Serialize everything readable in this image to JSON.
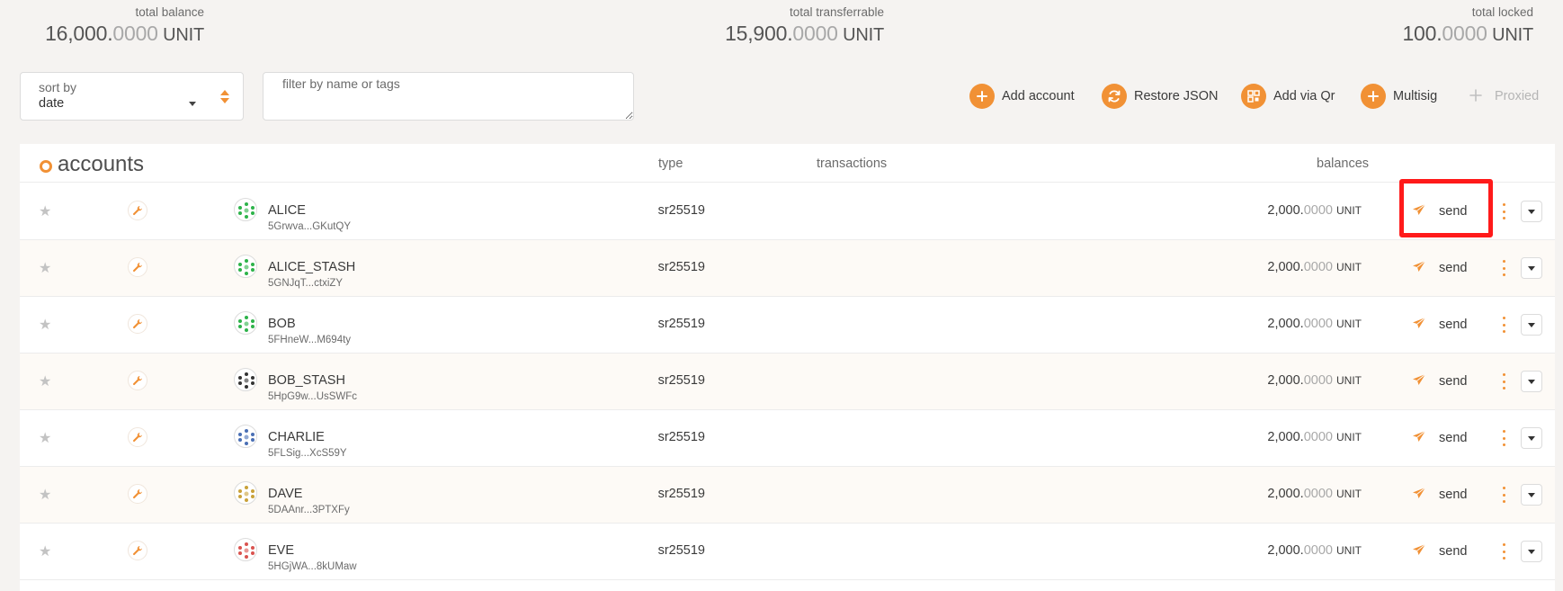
{
  "summary": {
    "total_balance": {
      "label": "total balance",
      "int": "16,000.",
      "dec": "0000",
      "unit": " UNIT"
    },
    "total_transferrable": {
      "label": "total transferrable",
      "int": "15,900.",
      "dec": "0000",
      "unit": " UNIT"
    },
    "total_locked": {
      "label": "total locked",
      "int": "100.",
      "dec": "0000",
      "unit": " UNIT"
    }
  },
  "controls": {
    "sort": {
      "label": "sort by",
      "value": "date"
    },
    "filter": {
      "placeholder": "filter by name or tags",
      "value": ""
    }
  },
  "actions": {
    "add_account": "Add account",
    "restore_json": "Restore JSON",
    "add_via_qr": "Add via Qr",
    "multisig": "Multisig",
    "proxied": "Proxied"
  },
  "table": {
    "title": "accounts",
    "columns": {
      "type": "type",
      "transactions": "transactions",
      "balances": "balances"
    },
    "send_label": "send",
    "rows": [
      {
        "name": "ALICE",
        "address": "5Grwva...GKutQY",
        "type": "sr25519",
        "bal_int": "2,000.",
        "bal_dec": "0000",
        "unit": "UNIT"
      },
      {
        "name": "ALICE_STASH",
        "address": "5GNJqT...ctxiZY",
        "type": "sr25519",
        "bal_int": "2,000.",
        "bal_dec": "0000",
        "unit": "UNIT"
      },
      {
        "name": "BOB",
        "address": "5FHneW...M694ty",
        "type": "sr25519",
        "bal_int": "2,000.",
        "bal_dec": "0000",
        "unit": "UNIT"
      },
      {
        "name": "BOB_STASH",
        "address": "5HpG9w...UsSWFc",
        "type": "sr25519",
        "bal_int": "2,000.",
        "bal_dec": "0000",
        "unit": "UNIT"
      },
      {
        "name": "CHARLIE",
        "address": "5FLSig...XcS59Y",
        "type": "sr25519",
        "bal_int": "2,000.",
        "bal_dec": "0000",
        "unit": "UNIT"
      },
      {
        "name": "DAVE",
        "address": "5DAAnr...3PTXFy",
        "type": "sr25519",
        "bal_int": "2,000.",
        "bal_dec": "0000",
        "unit": "UNIT"
      },
      {
        "name": "EVE",
        "address": "5HGjWA...8kUMaw",
        "type": "sr25519",
        "bal_int": "2,000.",
        "bal_dec": "0000",
        "unit": "UNIT"
      }
    ]
  },
  "colors": {
    "accent": "#f19135",
    "highlight": "#ff1a1a",
    "background": "#f5f3f1"
  },
  "icons": {
    "row": [
      "star-icon",
      "wrench-icon",
      "identicon",
      "send-icon",
      "kebab-icon",
      "chevron-down-icon"
    ],
    "actions": [
      "plus-icon",
      "refresh-icon",
      "qr-icon",
      "plus-icon",
      "plus-icon"
    ]
  }
}
